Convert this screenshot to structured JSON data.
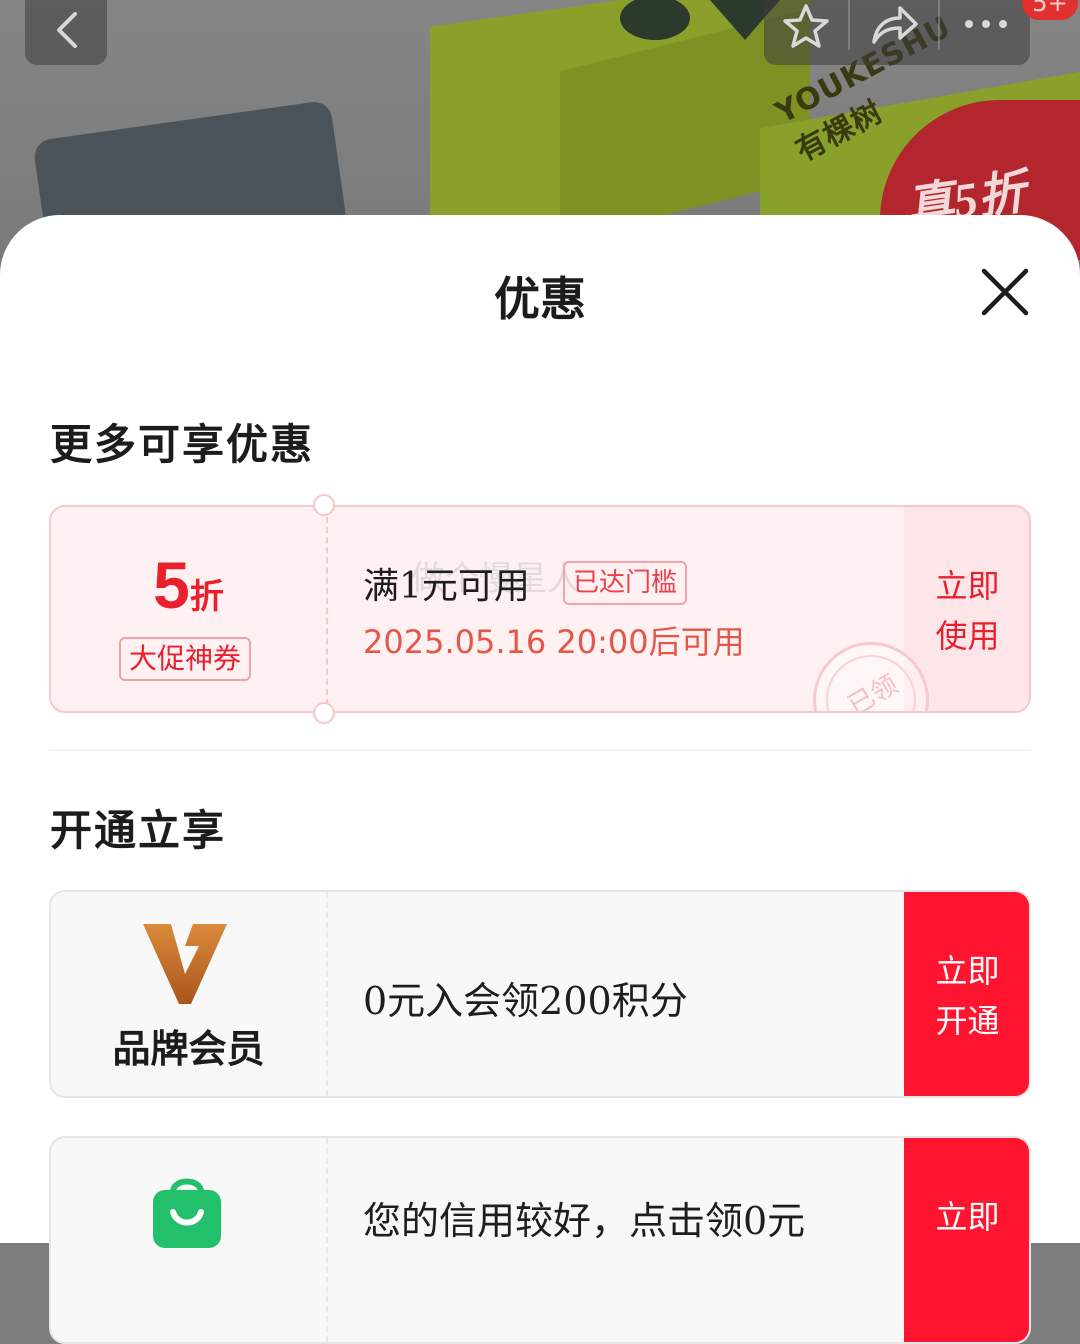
{
  "background": {
    "product_brand": "YOUKESHU",
    "product_brand_cn": "有棵树",
    "promo_badge": "真5折"
  },
  "toolbar": {
    "back_icon": "chevron-left-icon",
    "favorite_icon": "star-icon",
    "share_icon": "share-icon",
    "more_icon": "more-icon",
    "more_badge": "5+"
  },
  "sheet": {
    "title": "优惠",
    "close_icon": "close-icon"
  },
  "sections": {
    "more_offers": "更多可享优惠",
    "open_to_enjoy": "开通立享"
  },
  "coupon": {
    "discount_number": "5",
    "discount_unit": "折",
    "tag": "大促神券",
    "condition": "满1元可用",
    "condition_badge": "已达门槛",
    "valid_from": "2025.05.16 20:00后可用",
    "action_line1": "立即",
    "action_line2": "使用",
    "stamp": "已领",
    "watermark": "做个慢星人"
  },
  "members": [
    {
      "label": "品牌会员",
      "description": "0元入会领200积分",
      "action_line1": "立即",
      "action_line2": "开通",
      "icon": "brand-logo-icon"
    },
    {
      "label": "",
      "description": "您的信用较好，点击领0元",
      "action_line1": "立即",
      "action_line2": "",
      "icon": "shopping-bag-icon"
    }
  ],
  "colors": {
    "accent_red": "#ff1530",
    "coupon_bg": "#fff1f2",
    "brand_orange": "#c06a23",
    "bag_green": "#22c06a"
  }
}
